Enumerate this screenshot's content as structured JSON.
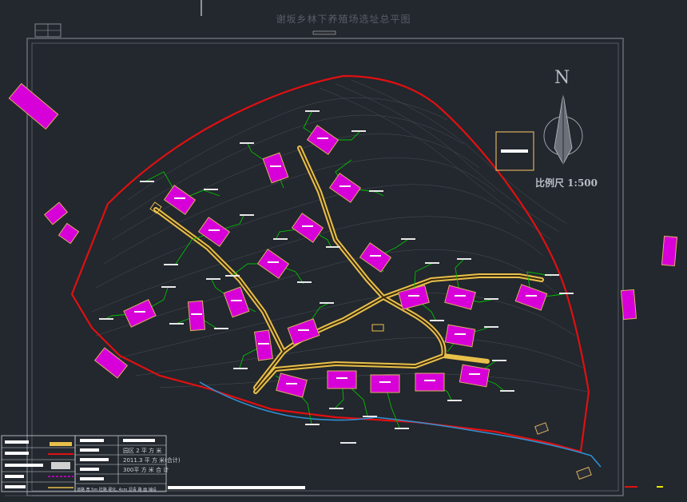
{
  "drawing": {
    "title": "谢坂乡林下养殖场选址总平图",
    "scale_label": "比例尺 1:500",
    "north_label": "N"
  },
  "legend": {
    "rows": [
      "园区 2 平 方 米",
      "2011.3 平 方 米(合计)",
      "300平 方 米 合 计"
    ],
    "note": "道路 宽 5m 砼路 硬化, 4cm 沥青 路 面 铺设"
  },
  "colors": {
    "background": "#23272e",
    "boundary": "#e01010",
    "road": "#e8c04a",
    "building": "#d800d8",
    "connector": "#00c000",
    "water": "#2f8fd0",
    "contour": "#4a4f57"
  }
}
